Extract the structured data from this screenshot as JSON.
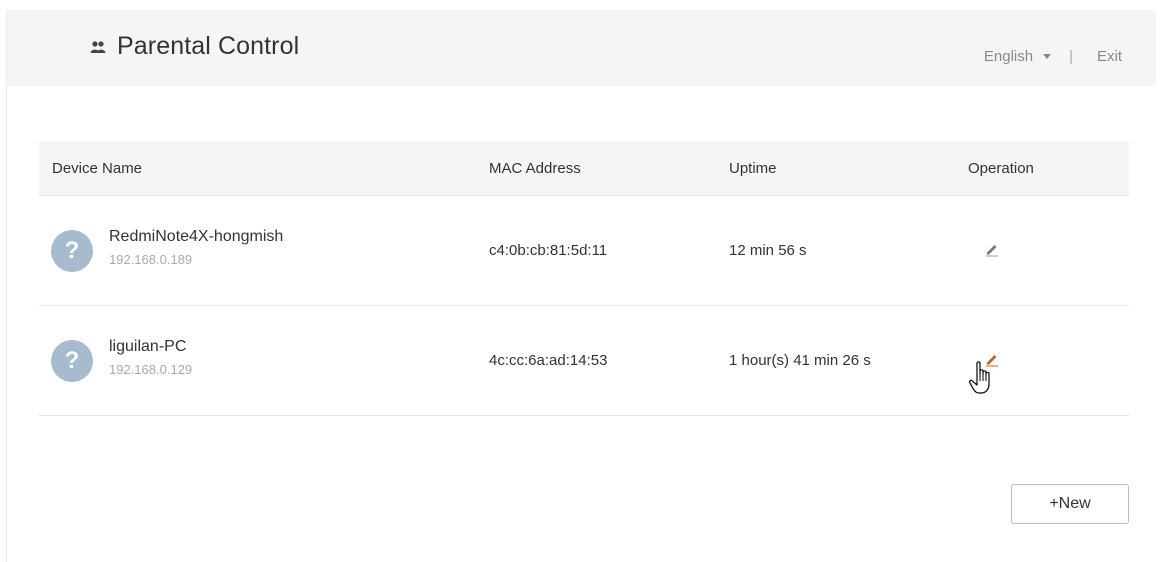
{
  "header": {
    "title": "Parental Control",
    "language": "English",
    "separator": "|",
    "exit_label": "Exit"
  },
  "table": {
    "columns": {
      "device_name": "Device Name",
      "mac_address": "MAC Address",
      "uptime": "Uptime",
      "operation": "Operation"
    },
    "rows": [
      {
        "name": "RedmiNote4X-hongmish",
        "ip": "192.168.0.189",
        "mac": "c4:0b:cb:81:5d:11",
        "uptime": "12 min 56 s",
        "avatar_glyph": "?"
      },
      {
        "name": "liguilan-PC",
        "ip": "192.168.0.129",
        "mac": "4c:cc:6a:ad:14:53",
        "uptime": "1 hour(s) 41 min 26 s",
        "avatar_glyph": "?"
      }
    ]
  },
  "actions": {
    "new_label": "+New"
  },
  "colors": {
    "header_bg": "#f5f5f5",
    "avatar_bg": "#a7bbcf",
    "edit_icon": "#777777",
    "edit_icon_hover": "#c0622f"
  },
  "icons": {
    "brand": "family-icon",
    "edit": "edit-pencil-icon",
    "cursor": "hand-pointer-cursor"
  }
}
